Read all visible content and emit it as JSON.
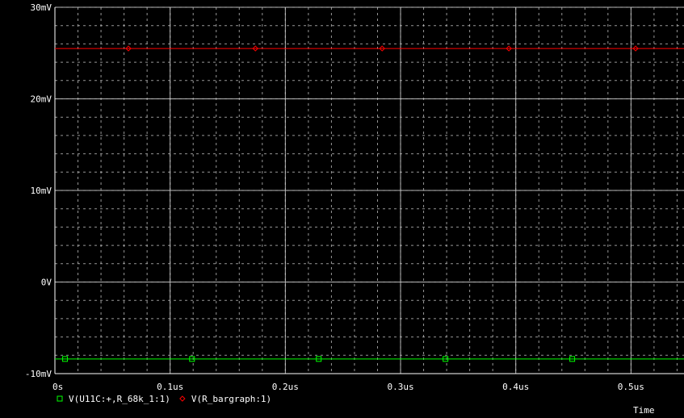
{
  "window": {
    "background_color": "#000000",
    "grid_color": "#c8c8c8",
    "axis_color": "#ffffff",
    "text_color": "#ffffff"
  },
  "chart_data": {
    "type": "line",
    "xlabel": "Time",
    "ylabel": "",
    "xlim": [
      0,
      0.546
    ],
    "ylim": [
      -10,
      30
    ],
    "x_ticks": [
      {
        "value": 0,
        "label": "0s"
      },
      {
        "value": 0.1,
        "label": "0.1us"
      },
      {
        "value": 0.2,
        "label": "0.2us"
      },
      {
        "value": 0.3,
        "label": "0.3us"
      },
      {
        "value": 0.4,
        "label": "0.4us"
      },
      {
        "value": 0.5,
        "label": "0.5us"
      }
    ],
    "y_ticks": [
      {
        "value": -10,
        "label": "-10mV"
      },
      {
        "value": 0,
        "label": "0V"
      },
      {
        "value": 10,
        "label": "10mV"
      },
      {
        "value": 20,
        "label": "20mV"
      },
      {
        "value": 30,
        "label": "30mV"
      }
    ],
    "grid": true,
    "legend_position": "bottom-left",
    "series": [
      {
        "name": "V(U11C:+,R_68k_1:1)",
        "color": "#00ff00",
        "marker": "square",
        "values": [
          -8.4,
          -8.4
        ],
        "x": [
          0,
          0.546
        ],
        "marker_x": [
          0.0088,
          0.119,
          0.229,
          0.339,
          0.449
        ]
      },
      {
        "name": "V(R_bargraph:1)",
        "color": "#ff0000",
        "marker": "diamond",
        "values": [
          25.5,
          25.5
        ],
        "x": [
          0,
          0.546
        ],
        "marker_x": [
          0.0638,
          0.174,
          0.284,
          0.394,
          0.504
        ]
      }
    ]
  }
}
